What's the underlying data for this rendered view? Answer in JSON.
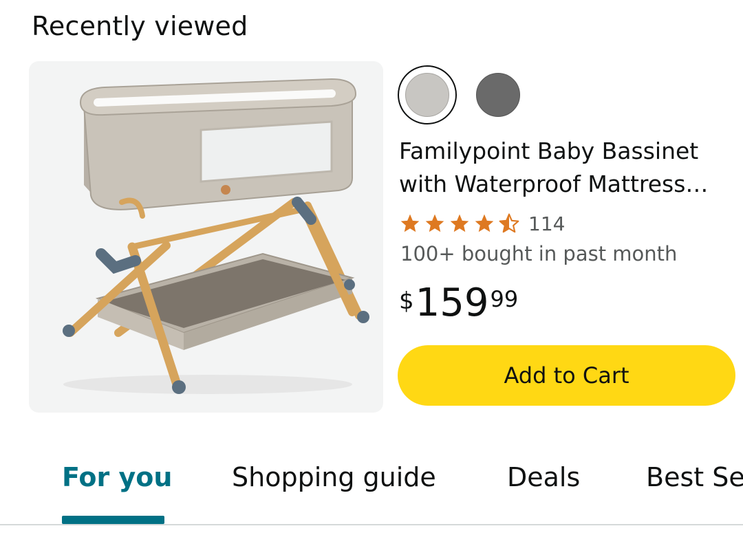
{
  "section": {
    "title": "Recently viewed"
  },
  "product": {
    "image_label": "baby-bassinet-image",
    "swatches": [
      {
        "name": "light-gray",
        "color": "#c8c6c2",
        "selected": true
      },
      {
        "name": "dark-gray",
        "color": "#6a6a6a",
        "selected": false
      }
    ],
    "title_line1": "Familypoint Baby Bassinet",
    "title_line2": "with Waterproof Mattress…",
    "rating": {
      "stars": 4.5,
      "count": "114"
    },
    "bought": "100+ bought in past month",
    "price": {
      "symbol": "$",
      "whole": "159",
      "fraction": "99"
    },
    "add_to_cart_label": "Add to Cart"
  },
  "tabs": [
    {
      "label": "For you",
      "active": true
    },
    {
      "label": "Shopping guide",
      "active": false
    },
    {
      "label": "Deals",
      "active": false
    },
    {
      "label": "Best Se",
      "active": false
    }
  ],
  "colors": {
    "accent": "#007185",
    "cart_button": "#ffd814",
    "star": "#de7921"
  }
}
